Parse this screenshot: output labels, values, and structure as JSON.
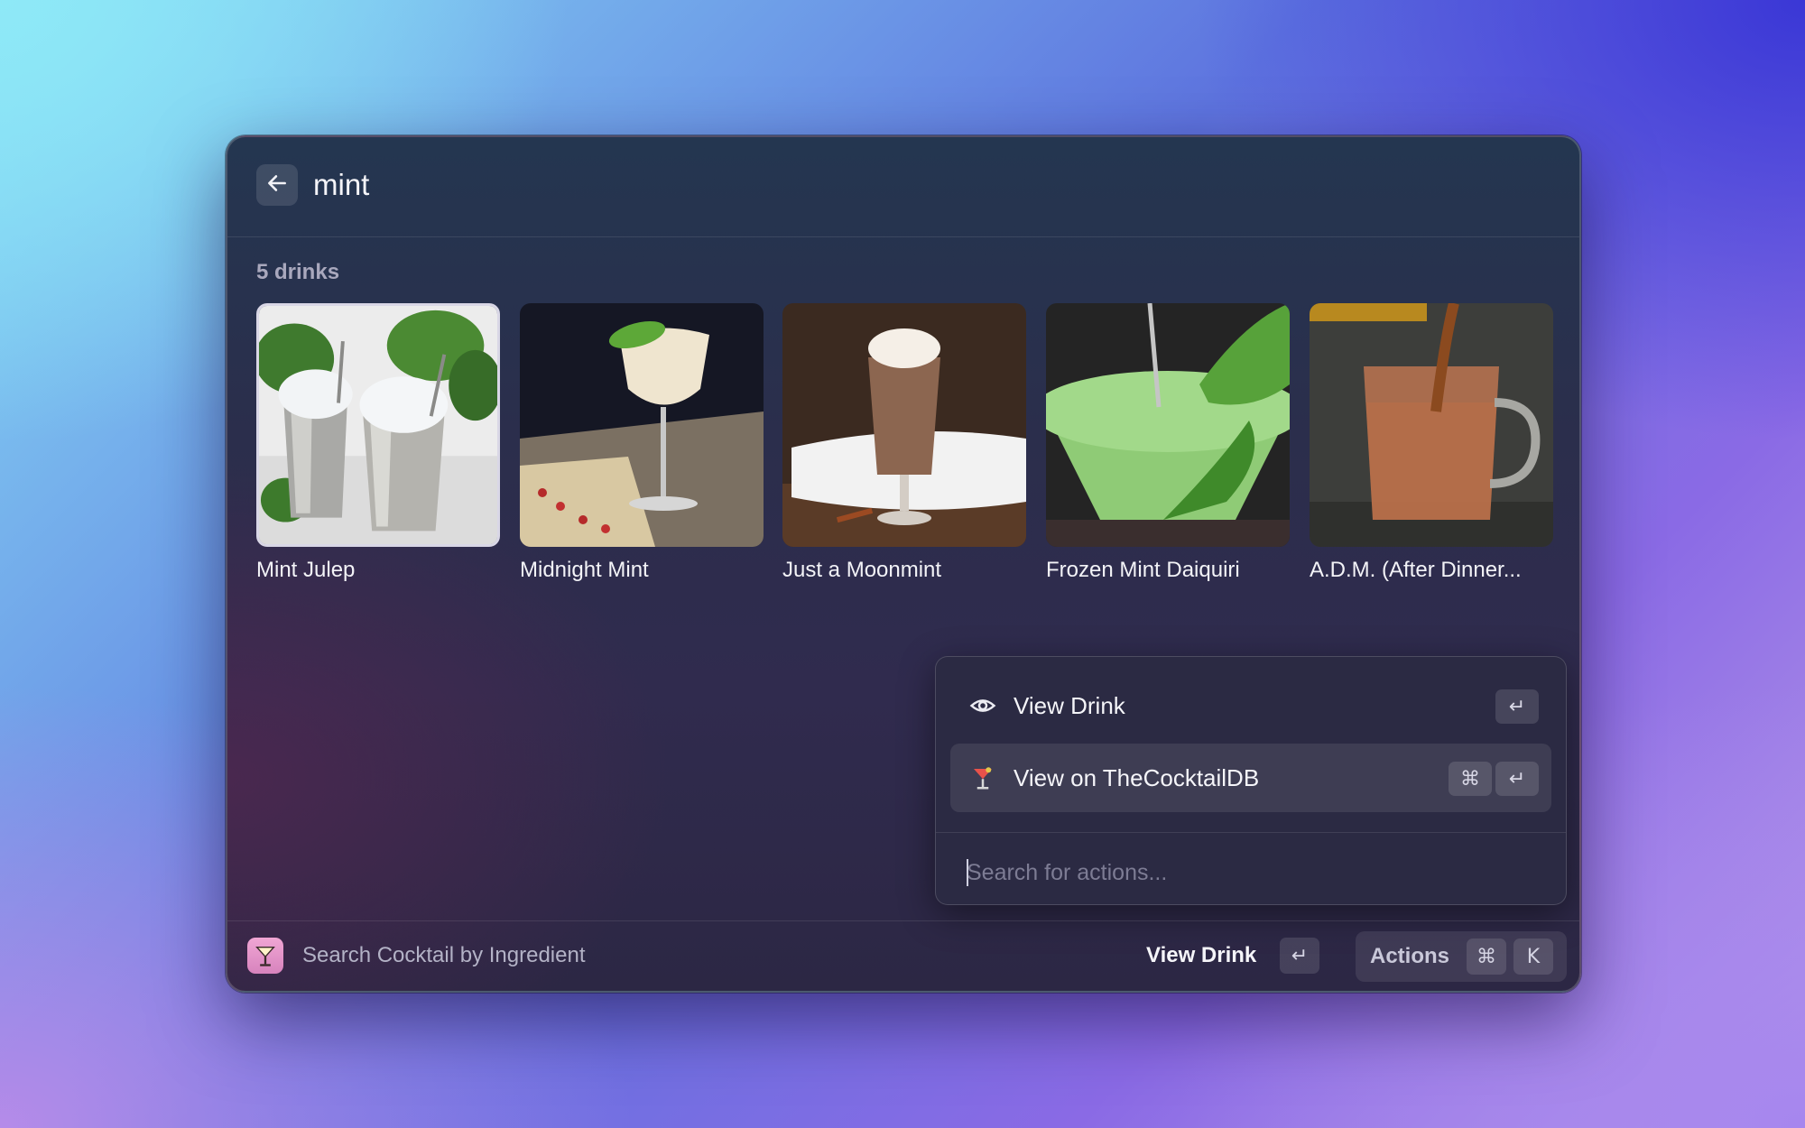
{
  "search": {
    "query": "mint"
  },
  "results": {
    "count_label": "5 drinks",
    "drinks": [
      {
        "name": "Mint Julep",
        "selected": true
      },
      {
        "name": "Midnight Mint",
        "selected": false
      },
      {
        "name": "Just a Moonmint",
        "selected": false
      },
      {
        "name": "Frozen Mint Daiquiri",
        "selected": false
      },
      {
        "name": "A.D.M. (After Dinner...",
        "selected": false
      }
    ]
  },
  "action_panel": {
    "actions": [
      {
        "label": "View Drink",
        "icon": "eye-icon",
        "shortcut": [
          "↵"
        ]
      },
      {
        "label": "View on TheCocktailDB",
        "icon": "cocktail-icon",
        "shortcut": [
          "⌘",
          "↵"
        ]
      }
    ],
    "search_placeholder": "Search for actions..."
  },
  "footer": {
    "title": "Search Cocktail by Ingredient",
    "primary_action": "View Drink",
    "primary_shortcut": "↵",
    "actions_label": "Actions",
    "actions_shortcut": [
      "⌘",
      "K"
    ]
  },
  "colors": {
    "selection_border": "#d9d7e6",
    "app_icon": "#e495c8"
  }
}
